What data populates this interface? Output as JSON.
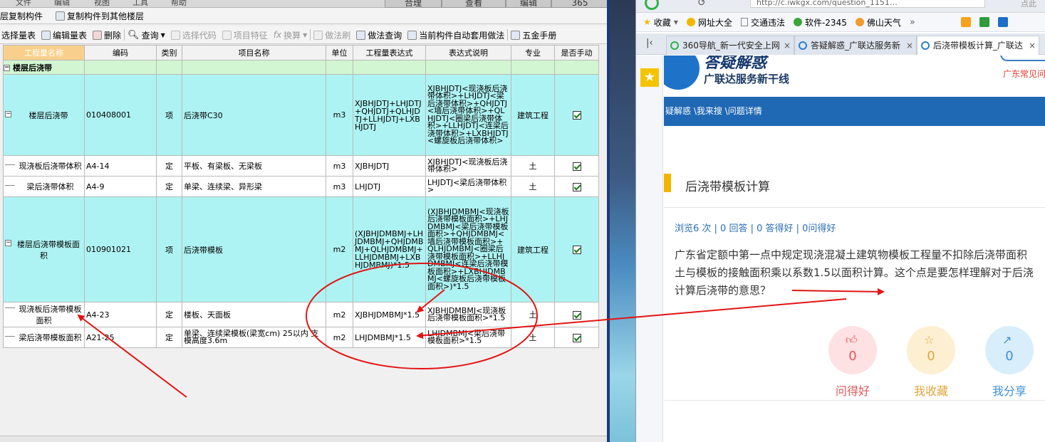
{
  "app": {
    "top_tabs": [
      "合理",
      "查看",
      "编辑",
      "365"
    ],
    "top_menu_fragments": [
      "文件",
      "编辑",
      "视图",
      "工具",
      "帮助"
    ],
    "toolbar1": [
      {
        "label": "层复制构件",
        "icon": "copy-icon"
      },
      {
        "label": "复制构件到其他楼层",
        "icon": "copy-floor-icon"
      }
    ],
    "toolbar2": [
      {
        "label": "选择量表",
        "icon": "table-icon",
        "enabled": true
      },
      {
        "label": "编辑量表",
        "icon": "edit-icon",
        "enabled": true
      },
      {
        "label": "删除",
        "icon": "delete-icon",
        "enabled": true
      },
      {
        "label": "查询",
        "icon": "search-icon",
        "enabled": true,
        "dropdown": true
      },
      {
        "label": "选择代码",
        "icon": "code-icon",
        "enabled": false
      },
      {
        "label": "项目特征",
        "icon": "feature-icon",
        "enabled": false
      },
      {
        "label": "换算",
        "icon": "convert-icon",
        "enabled": false,
        "dropdown": true
      },
      {
        "label": "做法刷",
        "icon": "brush-icon",
        "enabled": false
      },
      {
        "label": "做法查询",
        "icon": "method-search-icon",
        "enabled": true
      },
      {
        "label": "当前构件自动套用做法",
        "icon": "auto-apply-icon",
        "enabled": true
      },
      {
        "label": "五金手册",
        "icon": "handbook-icon",
        "enabled": true
      }
    ],
    "table": {
      "headers": [
        "工程量名称",
        "编码",
        "类别",
        "项目名称",
        "单位",
        "工程量表达式",
        "表达式说明",
        "专业",
        "是否手动"
      ],
      "group_label": "楼层后浇带",
      "rows": [
        {
          "name": "楼层后浇带",
          "code": "010408001",
          "type": "项",
          "item": "后浇带C30",
          "unit": "m3",
          "expr": "XJBHJDTJ+LHJDTJ+QHJDTJ+QLHJDTJ+LLHJDTJ+LXBHJDTJ",
          "desc": "XJBHJDTJ<现浇板后浇带体积>+LHJDTJ<梁后浇带体积>+QHJDTJ<墙后浇带体积>+QLHJDTJ<圈梁后浇带体积>+LLHJDTJ<连梁后浇带体积>+LXBHJDTJ<螺旋板后浇带体积>",
          "major": "建筑工程",
          "manual": true
        },
        {
          "name": "现浇板后浇带体积",
          "code": "A4-14",
          "type": "定",
          "item": "平板、有梁板、无梁板",
          "unit": "m3",
          "expr": "XJBHJDTJ",
          "desc": "XJBHJDTJ<现浇板后浇带体积>",
          "major": "土",
          "manual": true
        },
        {
          "name": "梁后浇带体积",
          "code": "A4-9",
          "type": "定",
          "item": "单梁、连续梁、异形梁",
          "unit": "m3",
          "expr": "LHJDTJ",
          "desc": "LHJDTJ<梁后浇带体积>",
          "major": "土",
          "manual": true
        },
        {
          "name": "楼层后浇带模板面积",
          "code": "010901021",
          "type": "项",
          "item": "后浇带模板",
          "unit": "m2",
          "expr": "(XJBHJDMBMJ+LHJDMBMJ+QHJDMBMJ+QLHJDMBMJ+LLHJDMBMJ+LXBHJDMBMJ)*1.5",
          "desc": "(XJBHJDMBMJ<现浇板后浇带模板面积>+LHJDMBMJ<梁后浇带模板面积>+QHJDMBMJ<墙后浇带模板面积>+QLHJDMBMJ<圈梁后浇带模板面积>+LLHJDMBMJ<连梁后浇带模板面积>+LXBHJDMBMJ<螺旋板后浇带模板面积>)*1.5",
          "major": "建筑工程",
          "manual": true
        },
        {
          "name": "现浇板后浇带模板面积",
          "code": "A4-23",
          "type": "定",
          "item": "楼板、天面板",
          "unit": "m2",
          "expr": "XJBHJDMBMJ*1.5",
          "desc": "XJBHJDMBMJ<现浇板后浇带模板面积>*1.5",
          "major": "土",
          "manual": true
        },
        {
          "name": "梁后浇带模板面积",
          "code": "A21-25",
          "type": "定",
          "item": "单梁、连续梁模板(梁宽cm) 25以内 支模高度3.6m",
          "unit": "m2",
          "expr": "LHJDMBMJ*1.5",
          "desc": "LHJDMBMJ<梁后浇带模板面积>*1.5",
          "major": "土",
          "manual": true
        }
      ]
    }
  },
  "browser": {
    "url": "http://c.iwkgx.com/question_1151…",
    "url_right": "点此",
    "bookmarks": [
      "收藏",
      "网址大全",
      "交通违法",
      "软件-2345",
      "佛山天气"
    ],
    "tabs": [
      {
        "label": "360导航_新一代安全上网",
        "active": false
      },
      {
        "label": "答疑解惑_广联达服务新",
        "active": false
      },
      {
        "label": "后浇带模板计算_广联达",
        "active": true
      }
    ],
    "brand": {
      "title": "答疑解惑",
      "subtitle": "广联达服务新干线",
      "right_text": "广东常见问"
    },
    "nav": "疑解惑 \\我来搜 \\问题详情",
    "question_title": "后浇带模板计算",
    "stats": "浏览6 次 | 0 回答 | 0 答得好 | 0问得好",
    "question_lines": [
      "广东省定额中第一点中规定现浇混凝土建筑物模板工程量不扣除后浇带面积",
      "土与模板的接触面积乘以系数1.5以面积计算。这个点是要怎样理解对于后浇",
      "计算后浇带的意思？"
    ],
    "actions": [
      {
        "label": "问得好",
        "count": "0",
        "icon": "thumbs-up-icon",
        "color": "#e2555a",
        "bg": "#fde1e3"
      },
      {
        "label": "我收藏",
        "count": "0",
        "icon": "star-icon",
        "color": "#e0a53a",
        "bg": "#fdf0d2"
      },
      {
        "label": "我分享",
        "count": "0",
        "icon": "share-icon",
        "color": "#3d8fd6",
        "bg": "#d9eefb"
      }
    ]
  }
}
